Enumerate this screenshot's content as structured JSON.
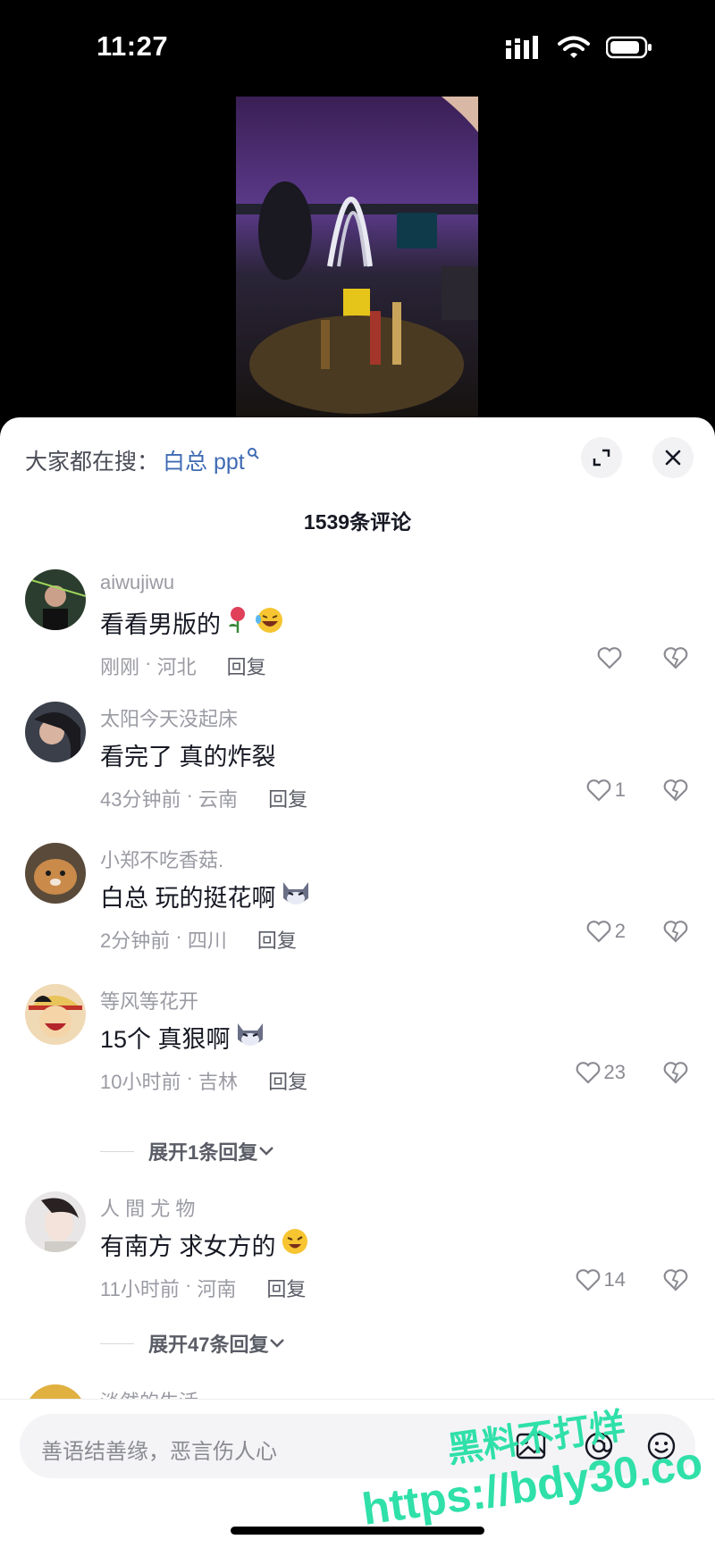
{
  "status_bar": {
    "time": "11:27"
  },
  "sheet": {
    "search_prefix": "大家都在搜：",
    "search_keyword": "白总 ppt",
    "comment_count_title": "1539条评论"
  },
  "comments": [
    {
      "username": "aiwujiwu",
      "text": "看看男版的",
      "time": "刚刚",
      "location": "河北",
      "reply": "回复",
      "likes": ""
    },
    {
      "username": "太阳今天没起床",
      "text": "看完了 真的炸裂",
      "time": "43分钟前",
      "location": "云南",
      "reply": "回复",
      "likes": "1"
    },
    {
      "username": "小郑不吃香菇.",
      "text": "白总 玩的挺花啊",
      "time": "2分钟前",
      "location": "四川",
      "reply": "回复",
      "likes": "2"
    },
    {
      "username": "等风等花开",
      "text": "15个 真狠啊",
      "time": "10小时前",
      "location": "吉林",
      "reply": "回复",
      "likes": "23",
      "expand": "展开1条回复"
    },
    {
      "username": "人 間 尤 物",
      "text": "有南方 求女方的",
      "time": "11小时前",
      "location": "河南",
      "reply": "回复",
      "likes": "14",
      "expand": "展开47条回复"
    }
  ],
  "partial_username": "淡然的生活",
  "input": {
    "placeholder": "善语结善缘，恶言伤人心"
  },
  "watermark": {
    "line1": "黑料不打烊",
    "line2": "https://bdy30.co"
  },
  "colors": {
    "accent_link": "#3f6bb3",
    "watermark": "#2fe0a8",
    "muted": "#9a9ba3"
  }
}
